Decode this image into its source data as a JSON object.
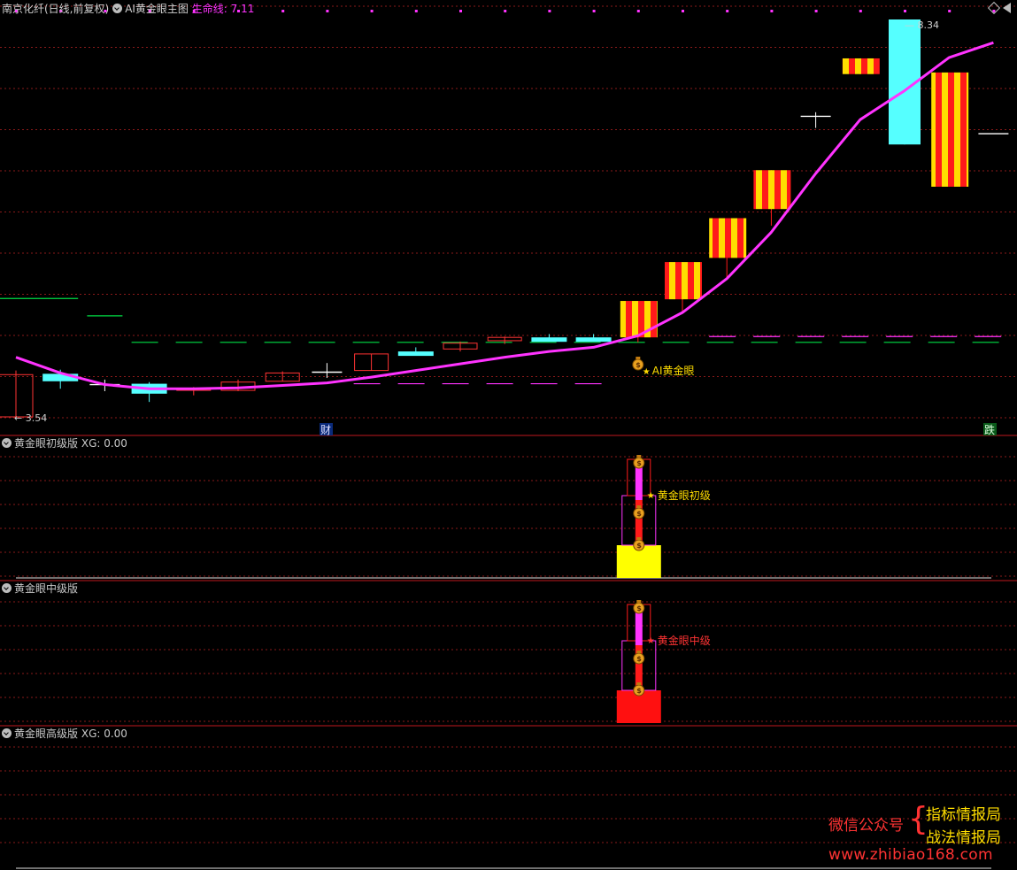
{
  "header": {
    "symbol": "南京化纤(日线,前复权)",
    "indicator": "AI黄金眼主图",
    "lifeline_label": "生命线: 7.11"
  },
  "price_labels": {
    "high": "8.34",
    "low": "3.54"
  },
  "axis_marks": {
    "cai": "财",
    "die": "跌"
  },
  "annotations": {
    "ai_eye": "AI黄金眼",
    "primary": "黄金眼初级",
    "middle": "黄金眼中级"
  },
  "panels": {
    "p1_title": "黄金眼初级版",
    "p1_xg": "XG: 0.00",
    "p2_title": "黄金眼中级版",
    "p3_title": "黄金眼高级版",
    "p3_xg": "XG: 0.00"
  },
  "watermark": {
    "wechat": "微信公众号",
    "brace": "{",
    "name1": "指标情报局",
    "name2": "战法情报局",
    "url": "www.zhibiao168.com"
  },
  "colors": {
    "up": "#ff3333",
    "down": "#55ffff",
    "lifeline": "#ff33ff",
    "stripe_yellow": "#ffdd00",
    "stripe_red": "#ff1a1a",
    "support": "#00dd44",
    "grid": "#8a1a1a",
    "divider": "#c0181e"
  },
  "chart_data": {
    "type": "candlestick",
    "candles": [
      {
        "o": 3.54,
        "c": 4.05,
        "h": 4.1,
        "l": 3.54,
        "style": "up"
      },
      {
        "o": 4.06,
        "c": 3.97,
        "h": 4.11,
        "l": 3.88,
        "style": "down"
      },
      {
        "o": 3.93,
        "c": 3.93,
        "h": 3.99,
        "l": 3.85,
        "style": "flat"
      },
      {
        "o": 3.94,
        "c": 3.82,
        "h": 3.96,
        "l": 3.72,
        "style": "down"
      },
      {
        "o": 3.86,
        "c": 3.88,
        "h": 3.9,
        "l": 3.8,
        "style": "up"
      },
      {
        "o": 3.86,
        "c": 3.96,
        "h": 3.99,
        "l": 3.85,
        "style": "up"
      },
      {
        "o": 3.97,
        "c": 4.07,
        "h": 4.09,
        "l": 3.97,
        "style": "up"
      },
      {
        "o": 4.08,
        "c": 4.08,
        "h": 4.19,
        "l": 4.01,
        "style": "flat"
      },
      {
        "o": 4.1,
        "c": 4.3,
        "h": 4.3,
        "l": 4.1,
        "style": "up"
      },
      {
        "o": 4.33,
        "c": 4.33,
        "h": 4.38,
        "l": 4.29,
        "style": "down"
      },
      {
        "o": 4.36,
        "c": 4.43,
        "h": 4.45,
        "l": 4.33,
        "style": "up"
      },
      {
        "o": 4.46,
        "c": 4.5,
        "h": 4.51,
        "l": 4.42,
        "style": "up"
      },
      {
        "o": 4.5,
        "c": 4.48,
        "h": 4.54,
        "l": 4.45,
        "style": "down"
      },
      {
        "o": 4.5,
        "c": 4.48,
        "h": 4.54,
        "l": 4.45,
        "style": "down"
      },
      {
        "o": 4.5,
        "c": 4.94,
        "h": 4.94,
        "l": 4.44,
        "style": "stripe"
      },
      {
        "o": 4.96,
        "c": 5.41,
        "h": 5.41,
        "l": 4.8,
        "style": "stripe"
      },
      {
        "o": 5.46,
        "c": 5.94,
        "h": 5.94,
        "l": 5.22,
        "style": "stripe"
      },
      {
        "o": 6.05,
        "c": 6.52,
        "h": 6.52,
        "l": 5.85,
        "style": "stripe"
      },
      {
        "o": 7.17,
        "c": 7.17,
        "h": 7.22,
        "l": 7.03,
        "style": "flat"
      },
      {
        "o": 7.68,
        "c": 7.87,
        "h": 7.87,
        "l": 7.68,
        "style": "stripe"
      },
      {
        "o": 8.34,
        "c": 6.83,
        "h": 8.34,
        "l": 6.83,
        "style": "down"
      },
      {
        "o": 7.7,
        "c": 6.32,
        "h": 7.7,
        "l": 6.32,
        "style": "stripe"
      },
      {
        "o": 6.96,
        "c": 6.96,
        "h": 6.96,
        "l": 6.96,
        "style": "flat"
      }
    ],
    "lifeline": [
      4.26,
      4.07,
      3.93,
      3.88,
      3.88,
      3.89,
      3.92,
      3.95,
      4.02,
      4.1,
      4.18,
      4.26,
      4.33,
      4.38,
      4.52,
      4.8,
      5.21,
      5.77,
      6.48,
      7.13,
      7.48,
      7.88,
      8.06
    ],
    "support_levels": [
      {
        "y": 4.97,
        "to": 1,
        "color": "#00dd44",
        "dash": "solid"
      },
      {
        "y": 4.76,
        "from": 2,
        "to": 2,
        "color": "#00dd44",
        "dash": "solid"
      },
      {
        "y": 4.44,
        "from": 3,
        "to": 22,
        "color": "#00dd44",
        "dash": "dash"
      },
      {
        "y": 4.51,
        "from": 16,
        "to": 22,
        "color": "#ff33ff",
        "dash": "dash"
      },
      {
        "y": 3.94,
        "from": 8,
        "to": 13,
        "color": "#ff33ff",
        "dash": "dash"
      }
    ],
    "signal_index": 14
  }
}
